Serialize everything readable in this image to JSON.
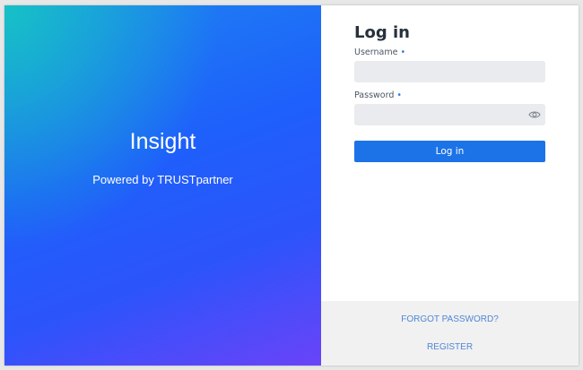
{
  "brand": {
    "title": "Insight",
    "subtitle": "Powered by TRUSTpartner"
  },
  "form": {
    "heading": "Log in",
    "username_label": "Username",
    "username_value": "",
    "password_label": "Password",
    "password_value": "",
    "required_marker": "•",
    "password_toggle_icon": "eye-icon",
    "submit_label": "Log in"
  },
  "footer": {
    "forgot_password": "FORGOT PASSWORD?",
    "register": "REGISTER"
  },
  "colors": {
    "gradient_top_left": "#16c4c4",
    "gradient_mid": "#1e60fb",
    "gradient_bottom_right": "#6a43f8",
    "button": "#1c73e8",
    "link": "#4f86d6",
    "input_bg": "#e9ebee",
    "footer_bg": "#f1f1f1"
  }
}
